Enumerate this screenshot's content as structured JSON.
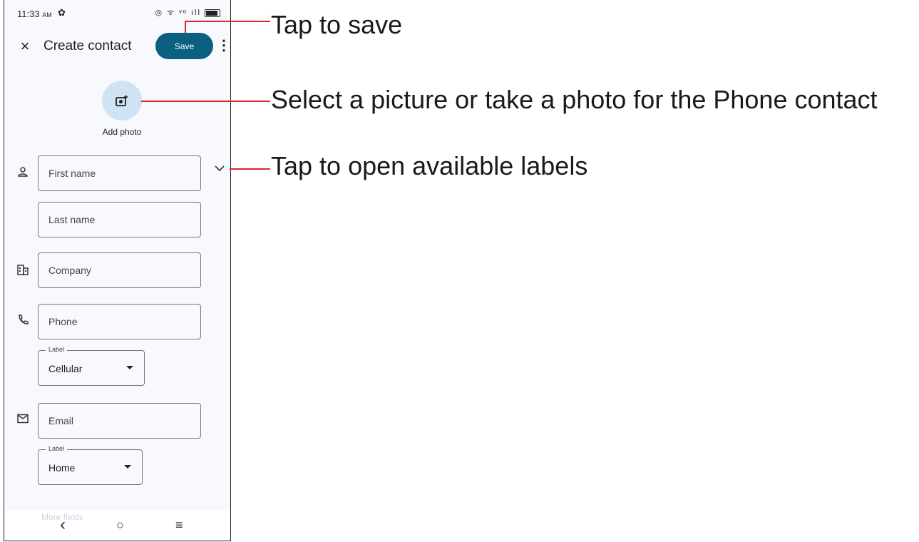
{
  "status_bar": {
    "time": "11:33",
    "ampm": "AM",
    "gear": "✿",
    "right_icons": "◎ ᯤ ᵛᵒ ıll"
  },
  "header": {
    "close_glyph": "×",
    "title": "Create contact",
    "save_label": "Save",
    "more_glyph": "⋮"
  },
  "photo": {
    "label": "Add photo",
    "icon": "add-photo-icon"
  },
  "fields": {
    "first_name": "First name",
    "last_name": "Last name",
    "company": "Company",
    "phone": "Phone",
    "email": "Email"
  },
  "phone_label": {
    "legend": "Label",
    "value": "Cellular"
  },
  "email_label": {
    "legend": "Label",
    "value": "Home"
  },
  "more_fields": "More fields",
  "nav": {
    "back": "‹",
    "home": "○",
    "recents": "≡"
  },
  "callouts": {
    "save": "Tap to save",
    "photo": "Select a picture or take a photo for the Phone contact",
    "labels": "Tap to open available labels"
  },
  "colors": {
    "accent": "#0b5f80",
    "photo_bg": "#cfe3f3",
    "callout_line": "#e0222c"
  }
}
